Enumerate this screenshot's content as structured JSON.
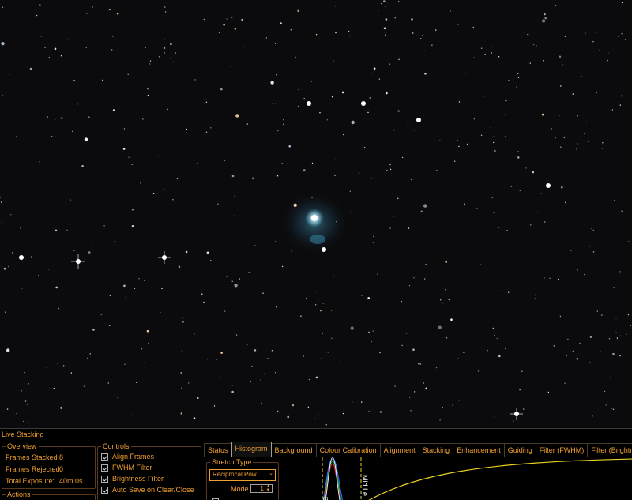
{
  "panel": {
    "title": "Live Stacking",
    "overview": {
      "title": "Overview",
      "frames_stacked_label": "Frames Stacked:",
      "frames_stacked_value": "8",
      "frames_rejected_label": "Frames Rejected:",
      "frames_rejected_value": "0",
      "total_exposure_label": "Total Exposure:",
      "total_exposure_value": "40m 0s"
    },
    "actions": {
      "title": "Actions"
    },
    "controls": {
      "title": "Controls",
      "items": [
        {
          "label": "Align Frames",
          "checked": true
        },
        {
          "label": "FWHM Filter",
          "checked": true
        },
        {
          "label": "Brightness Filter",
          "checked": true
        },
        {
          "label": "Auto Save on Clear/Close",
          "checked": true
        }
      ]
    },
    "tabs": [
      "Status",
      "Histogram",
      "Background",
      "Colour Calibration",
      "Alignment",
      "Stacking",
      "Enhancement",
      "Guiding",
      "Filter (FWHM)",
      "Filter (Brightness)"
    ],
    "active_tab": "Histogram",
    "histogram": {
      "stretch_type_title": "Stretch Type",
      "stretch_type_value": "Reciprocal Pow",
      "mode_label": "Mode",
      "mode_value": "1",
      "black_marker_label": "Bl",
      "mid_marker_label": "Mid Le"
    },
    "colors": {
      "accent": "#f0a030",
      "curve": "#e8d020"
    }
  }
}
